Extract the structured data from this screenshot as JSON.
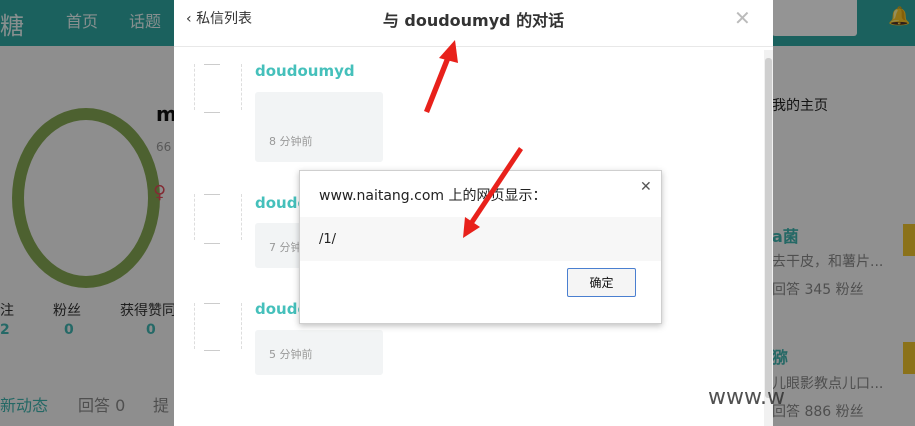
{
  "background": {
    "logo_char": "糖",
    "nav": [
      "首页",
      "话题"
    ],
    "profile": {
      "name_initial": "m",
      "sub_text": "66",
      "stats": [
        {
          "label": "注",
          "value": "2"
        },
        {
          "label": "粉丝",
          "value": "0"
        },
        {
          "label": "获得赞同",
          "value": "0"
        }
      ],
      "tabs": [
        "新动态",
        "回答 0",
        "提"
      ]
    },
    "right": {
      "home_link": "我的主页",
      "items": [
        {
          "title": "a菌",
          "desc": "去干皮，和薯片...",
          "stat": "回答 345 粉丝"
        },
        {
          "title": "猕",
          "desc": "儿眼影教点儿口...",
          "stat": "回答 886 粉丝"
        }
      ]
    },
    "accent": "#2fa8a2"
  },
  "modal": {
    "back_label": "私信列表",
    "title": "与 doudoumyd 的对话",
    "messages": [
      {
        "name": "doudoumyd",
        "time": "8 分钟前"
      },
      {
        "name": "doudo",
        "time": "7 分钟前"
      },
      {
        "name": "doudo",
        "time": "5 分钟前"
      }
    ]
  },
  "alert_dialog": {
    "title": "www.naitang.com 上的网页显示：",
    "message": "/1/",
    "ok_label": "确定"
  },
  "watermark": "www.w"
}
